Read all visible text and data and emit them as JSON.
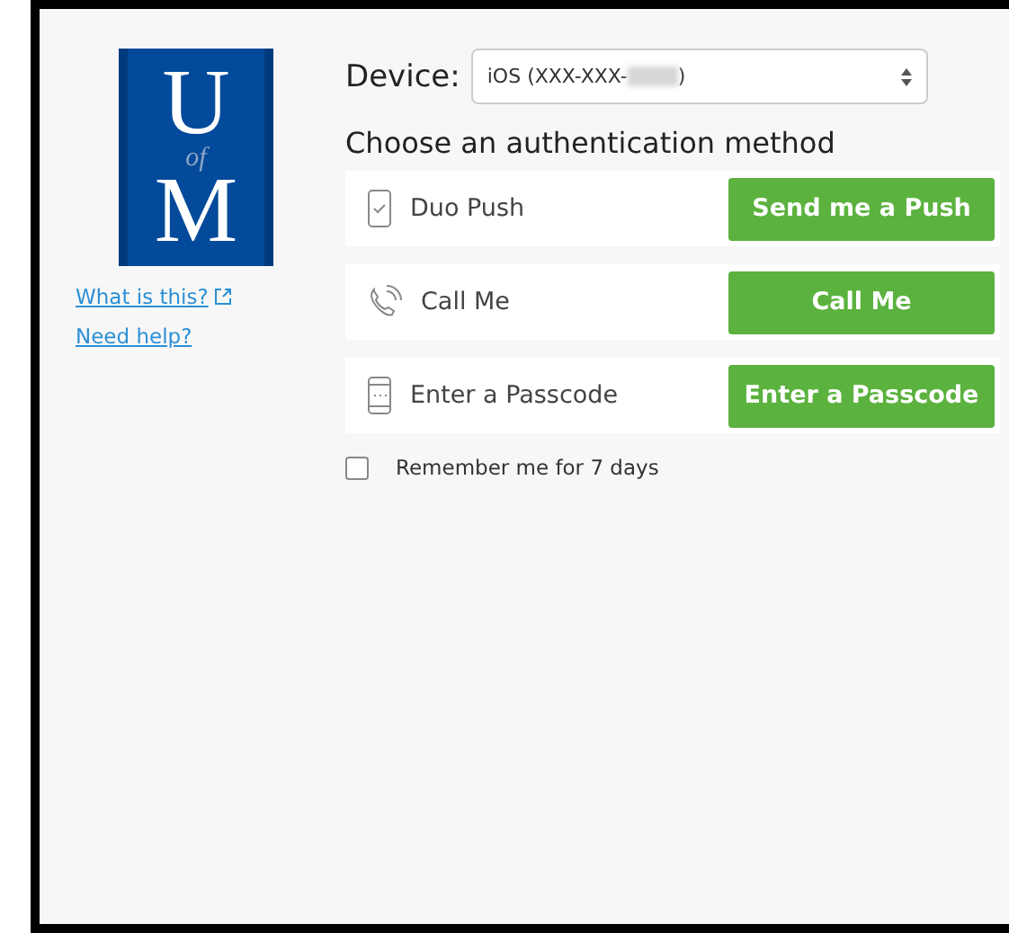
{
  "logo": {
    "letters": [
      "U",
      "of",
      "M"
    ]
  },
  "links": [
    {
      "label": "What is this?",
      "external": true
    },
    {
      "label": "Need help?",
      "external": false
    }
  ],
  "device": {
    "label": "Device:",
    "value": "iOS (XXX-XXX-",
    "value_suffix": ")",
    "redacted": true
  },
  "heading": "Choose an authentication method",
  "methods": [
    {
      "kind": "push",
      "label": "Duo Push",
      "button": "Send me a Push"
    },
    {
      "kind": "phone",
      "label": "Call Me",
      "button": "Call Me"
    },
    {
      "kind": "passcode",
      "label": "Enter a Passcode",
      "button": "Enter a Passcode"
    }
  ],
  "remember": {
    "label": "Remember me for 7 days",
    "checked": false
  }
}
